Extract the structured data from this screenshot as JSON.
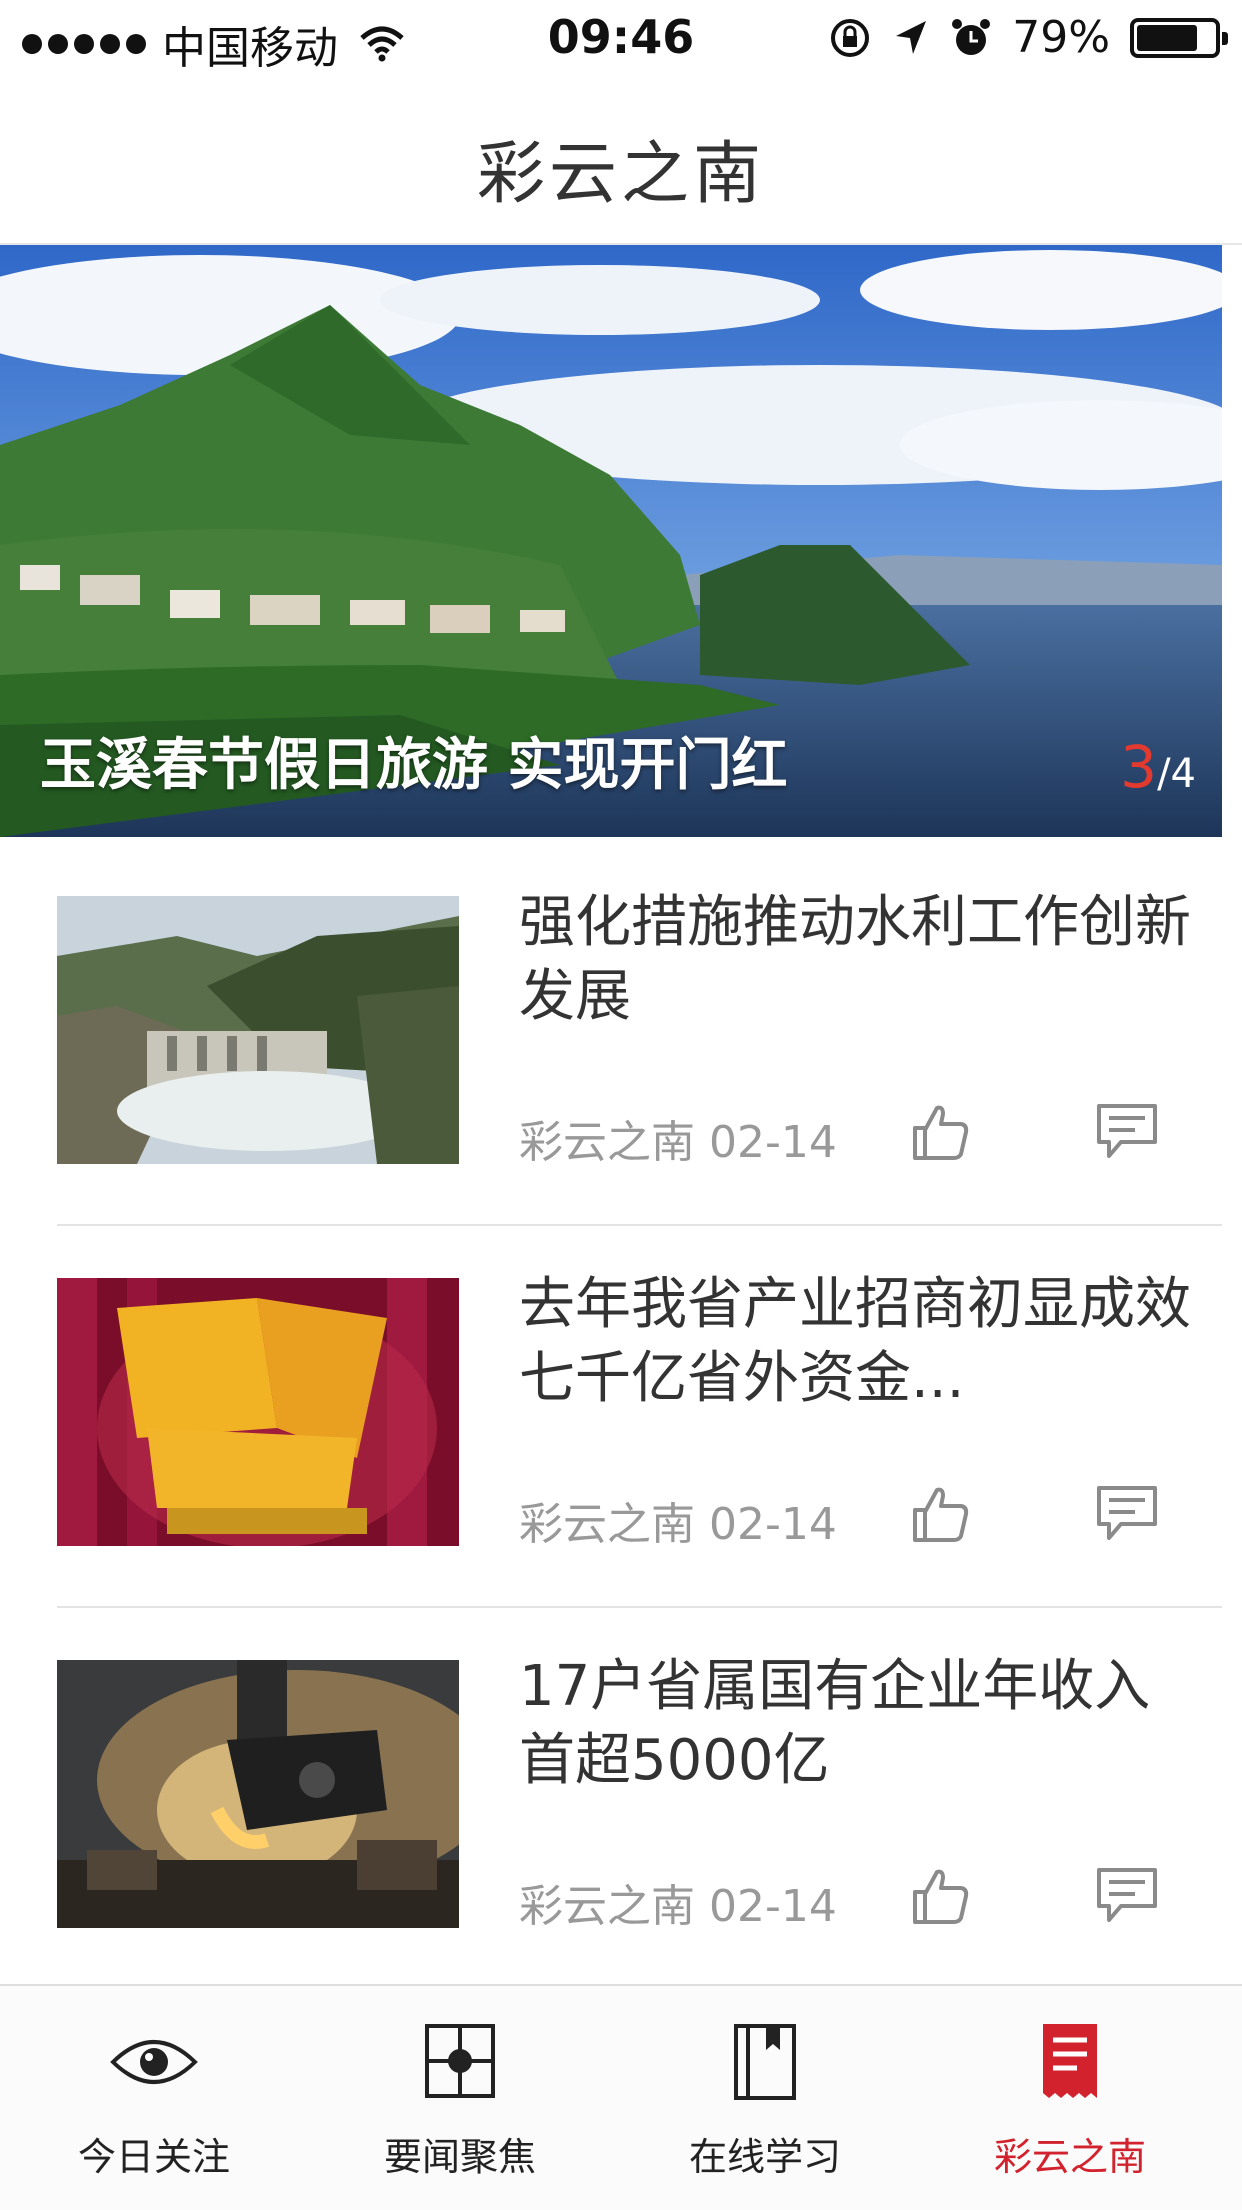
{
  "status_bar": {
    "carrier": "中国移动",
    "time": "09:46",
    "battery": "79%",
    "battery_level": 0.79
  },
  "nav": {
    "title": "彩云之南"
  },
  "banner": {
    "caption": "玉溪春节假日旅游 实现开门红",
    "current": "3",
    "total": "/4"
  },
  "news": [
    {
      "title": "强化措施推动水利工作创新发展",
      "source": "彩云之南",
      "date": "02-14"
    },
    {
      "title": "去年我省产业招商初显成效 七千亿省外资金...",
      "source": "彩云之南",
      "date": "02-14"
    },
    {
      "title": "17户省属国有企业年收入首超5000亿",
      "source": "彩云之南",
      "date": "02-14"
    }
  ],
  "tabbar": {
    "tabs": [
      {
        "label": "今日关注",
        "icon": "eye-icon"
      },
      {
        "label": "要闻聚焦",
        "icon": "focus-icon"
      },
      {
        "label": "在线学习",
        "icon": "book-icon"
      },
      {
        "label": "彩云之南",
        "icon": "document-icon"
      }
    ],
    "active_color": "#d2222d"
  }
}
